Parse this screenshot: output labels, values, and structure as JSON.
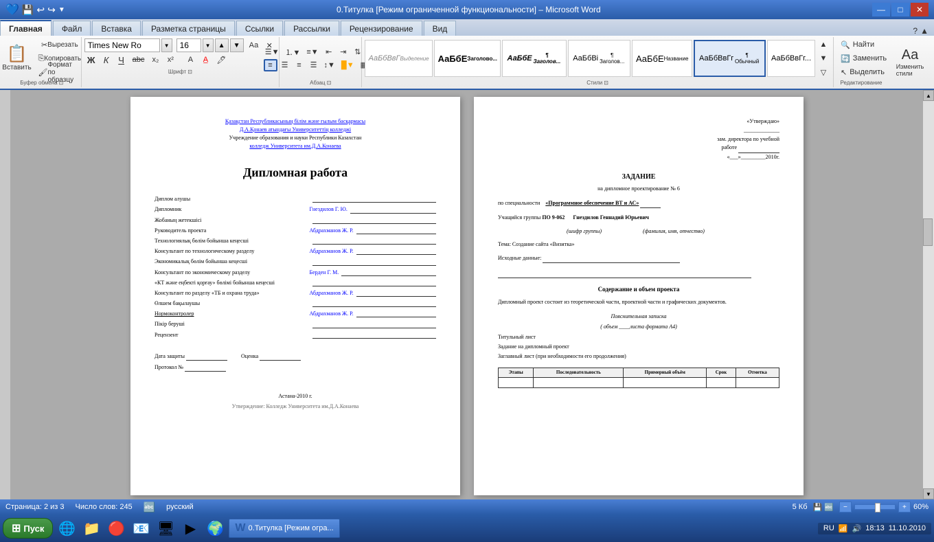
{
  "titlebar": {
    "title": "0.Титулка [Режим ограниченной функциональности] – Microsoft Word",
    "min": "—",
    "max": "□",
    "close": "✕"
  },
  "quicktoolbar": {
    "save": "💾",
    "undo": "↩",
    "redo": "↪",
    "more": "▼"
  },
  "ribbon": {
    "tabs": [
      "Файл",
      "Главная",
      "Вставка",
      "Разметка страницы",
      "Ссылки",
      "Рассылки",
      "Рецензирование",
      "Вид"
    ],
    "active_tab": "Главная",
    "groups": {
      "clipboard": {
        "label": "Буфер обмена",
        "insert_label": "Вставить",
        "cut": "Вырезать",
        "copy": "Копировать",
        "format": "Формат по образцу"
      },
      "font": {
        "label": "Шрифт",
        "name": "Times New Ro",
        "size": "16",
        "bold": "Ж",
        "italic": "К",
        "underline": "Ч",
        "strikethrough": "abc",
        "subscript": "x₂",
        "superscript": "x²"
      },
      "paragraph": {
        "label": "Абзац"
      },
      "styles": {
        "label": "Стили",
        "items": [
          "Выделение",
          "Заголово...",
          "¶ Заголов...",
          "¶ Заголов...",
          "Название",
          "¶ Обычный",
          "АаБбВвГг..."
        ]
      },
      "editing": {
        "label": "Редактирование",
        "find": "Найти",
        "replace": "Заменить",
        "select": "Выделить"
      }
    }
  },
  "page_left": {
    "header_line1": "Қазақстан Республикасының білім және ғылым басқармасы",
    "header_line2": "Д.А.Қонаев атындағы Университеттің колледжі",
    "header_line3": "Учреждение образования и науки Республики Казахстан",
    "header_line4": "колледж Университета им.Д.А.Конаева",
    "title": "Дипломная работа",
    "rows": [
      {
        "label": "Диплом алушы"
      },
      {
        "label": "Дипломник"
      },
      {
        "label": "Жобаның жетекшісі"
      },
      {
        "label": "Руководитель проекта",
        "value": "Абдрахманов Ж. Р."
      },
      {
        "label": "Технологиялық бөлім бойынша кеңесші"
      },
      {
        "label": "Консультант по технологическому разделу",
        "value": "Абдрахманов Ж. Р."
      },
      {
        "label": "Экономикалық бөлім бойынша кеңесші"
      },
      {
        "label": "Консультант по экономическому разделу",
        "value": "Берден Г. М."
      },
      {
        "label": "«КТ және еңбекті қорғау» бөлімі бойынша кеңесші"
      },
      {
        "label": "Консультант по разделу «ТБ и охрана труда»",
        "value": "Абдрахманов Ж. Р."
      },
      {
        "label": "Өлшем бақылаушы"
      },
      {
        "label": "Нормоконтролер",
        "value": "Абдрахманов Ж. Р."
      },
      {
        "label": "Пікір берушi"
      },
      {
        "label": "Рецензент"
      }
    ],
    "defense_date_label": "Дата защиты",
    "grade_label": "Оценка",
    "gnezdiloff_label": "Гнездилов Г. Ю.",
    "diploma_num_label": "Протокол №",
    "footer": "Астана-2010 г."
  },
  "page_right": {
    "approved_label": "«Утверждаю»",
    "approved_line": "_____________",
    "deputy_label": "зам. директора по учебной",
    "work_label": "работе",
    "work_line": "_______________",
    "date_prefix": "«___»_________2010г.",
    "title": "ЗАДАНИЕ",
    "subtitle": "на дипломное проектирование № 6",
    "specialty_label": "по специальности",
    "specialty_value": "«Программное обеспечение ВТ и АС»",
    "student_label": "Учащийся группы",
    "group_code": "ПО 9-062",
    "group_code_sub": "(шифр группы)",
    "student_name": "Гнездилов Геннадий Юрьевич",
    "student_name_sub": "(фамилия, имя, отчество)",
    "theme_label": "Тема:",
    "theme_value": "Создание сайта «Визитка»",
    "initial_data_label": "Исходные данные:",
    "initial_data_line1": "_______________________________________________",
    "initial_data_line2": "_______________________________________________",
    "content_title": "Содержание и объем проекта",
    "content_text": "Дипломный проект состоит из теоретической части, проектной части и графических документов.",
    "note_title": "Пояснительная записка",
    "note_volume": "( объем ____листа формата А4)",
    "item1": "Титульный лист",
    "item2": "Задание на дипломный проект",
    "item3": "Заглавный лист (при необходимости его продолжения)",
    "table_header": {
      "col1": "Этапы",
      "col2": "Последовательность",
      "col3": "Примерный объём",
      "col4": "Срок",
      "col5": "Отметка"
    }
  },
  "statusbar": {
    "page_info": "Страница: 2 из 3",
    "words": "Число слов: 245",
    "lang": "русский",
    "file_size": "5 Кб",
    "zoom_level": "60%"
  },
  "taskbar": {
    "start_label": "Пуск",
    "active_window": "0.Титулка [Режим огра...",
    "time": "18:13",
    "date": "11.10.2010",
    "lang_indicator": "RU"
  }
}
